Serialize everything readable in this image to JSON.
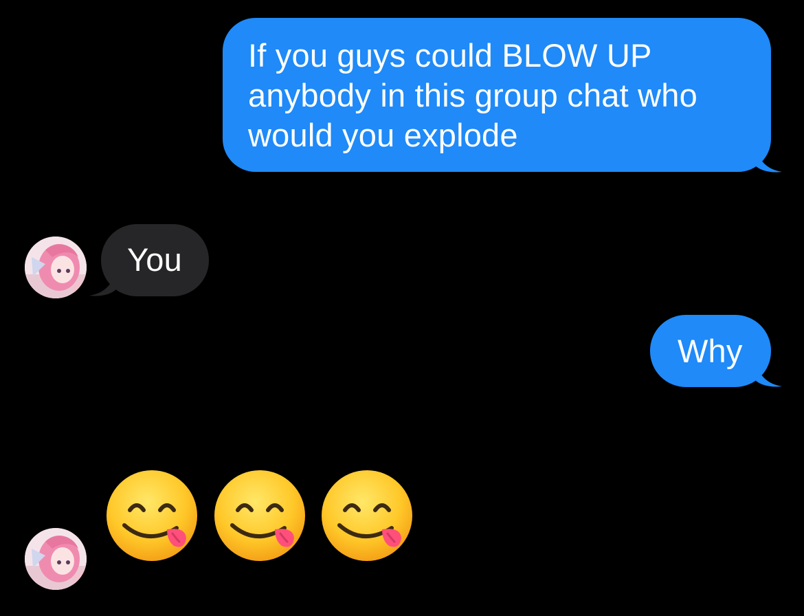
{
  "conversation": {
    "messages": [
      {
        "direction": "outgoing",
        "text": "If you guys could BLOW UP anybody in this group chat who would you explode"
      },
      {
        "direction": "incoming",
        "text": "You"
      },
      {
        "direction": "outgoing",
        "text": "Why"
      },
      {
        "direction": "incoming",
        "emoji": [
          "face-savoring-food",
          "face-savoring-food",
          "face-savoring-food"
        ]
      }
    ]
  },
  "colors": {
    "background": "#000000",
    "outgoing_bubble": "#1f8af8",
    "incoming_bubble": "#262628",
    "text": "#ffffff"
  }
}
